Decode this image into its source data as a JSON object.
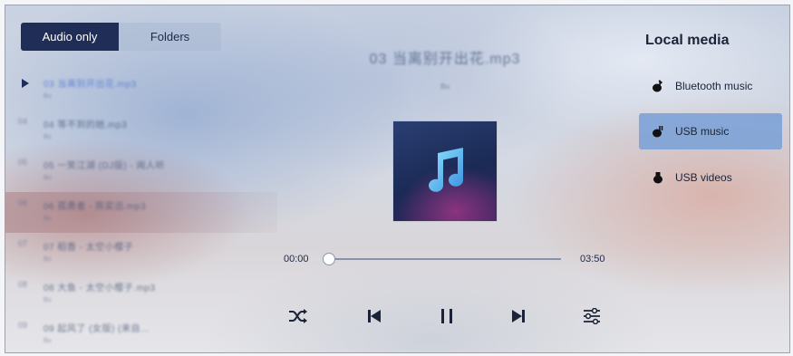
{
  "tabs": [
    {
      "label": "Audio only",
      "active": true
    },
    {
      "label": "Folders",
      "active": false
    }
  ],
  "playlist": [
    {
      "num": "",
      "title": "03 当离别开出花.mp3",
      "artist": "Bu",
      "playing": true
    },
    {
      "num": "04",
      "title": "04 等不到的她.mp3",
      "artist": "Bu",
      "playing": false
    },
    {
      "num": "05",
      "title": "05 一笑江湖 (DJ版) - 闻人听",
      "artist": "Bu",
      "playing": false
    },
    {
      "num": "06",
      "title": "06 孤勇者 - 陈奕迅.mp3",
      "artist": "Bu",
      "playing": false
    },
    {
      "num": "07",
      "title": "07 稻香 - 太空小樱子",
      "artist": "Bu",
      "playing": false
    },
    {
      "num": "08",
      "title": "08 大鱼 - 太空小樱子.mp3",
      "artist": "Bu",
      "playing": false
    },
    {
      "num": "09",
      "title": "09 起风了 (女版) (来自...",
      "artist": "Bu",
      "playing": false
    }
  ],
  "player": {
    "song_title": "03 当离别开出花.mp3",
    "artist": "Bu",
    "current_time": "00:00",
    "total_time": "03:50",
    "progress": 0.0
  },
  "local_media": {
    "title": "Local media",
    "items": [
      {
        "label": "Bluetooth music",
        "icon": "bluetooth-music-icon",
        "active": false
      },
      {
        "label": "USB music",
        "icon": "usb-music-icon",
        "active": true
      },
      {
        "label": "USB videos",
        "icon": "usb-video-icon",
        "active": false
      }
    ]
  },
  "colors": {
    "accent_dark": "#1f2d57",
    "active_item": "#78a0d7"
  }
}
